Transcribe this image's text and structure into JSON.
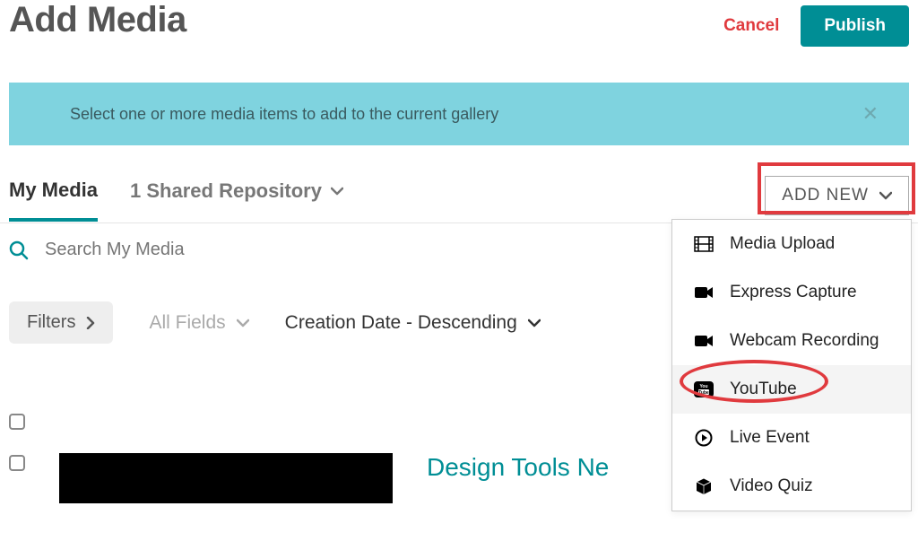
{
  "header": {
    "title": "Add Media",
    "cancel": "Cancel",
    "publish": "Publish"
  },
  "banner": {
    "text": "Select one or more media items to add to the current gallery"
  },
  "tabs": {
    "my_media": "My Media",
    "shared": "1 Shared Repository"
  },
  "add_new_label": "ADD NEW",
  "search": {
    "placeholder": "Search My Media"
  },
  "filters": {
    "button": "Filters",
    "fields": "All Fields",
    "sort": "Creation Date - Descending"
  },
  "menu": {
    "media_upload": "Media Upload",
    "express_capture": "Express Capture",
    "webcam_recording": "Webcam Recording",
    "youtube": "YouTube",
    "live_event": "Live Event",
    "video_quiz": "Video Quiz"
  },
  "results": {
    "item1_title": "Design Tools Ne"
  }
}
